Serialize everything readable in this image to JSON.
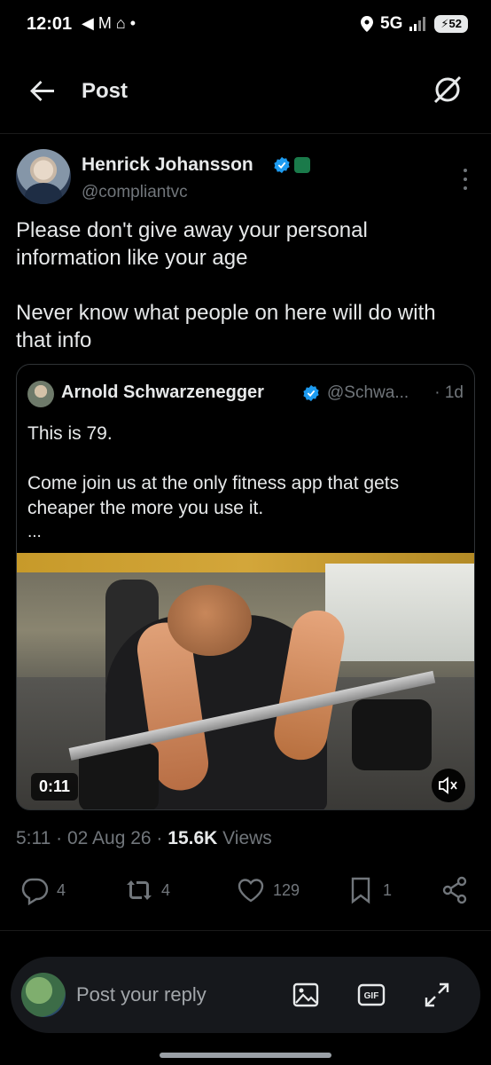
{
  "status_bar": {
    "time": "12:01",
    "left_icons": "◀ M ⌂ •",
    "network": "5G",
    "battery": "52"
  },
  "header": {
    "title": "Post",
    "back_icon": "arrow-left-icon",
    "grok_icon": "grok-icon"
  },
  "author": {
    "name": "Henrick Johansson",
    "handle": "@compliantvc",
    "verified_color": "#1d9bf0",
    "affiliation_color": "#1a7a4a"
  },
  "post": {
    "text": "Please don't give away your personal information like your age\n\nNever know what people on here will do with that info"
  },
  "quote": {
    "name": "Arnold Schwarzenegger",
    "handle": "@Schwa...",
    "time": "· 1d",
    "text": "This is 79.\n\nCome join us at the only fitness app that gets cheaper the more you use it.",
    "more": "...",
    "video": {
      "duration": "0:11",
      "mute_icon": "volume-mute-icon"
    }
  },
  "meta": {
    "time": "5:11",
    "sep1": " · ",
    "date": "02 Aug 26",
    "sep2": " · ",
    "views_count": "15.6K",
    "views_label": " Views"
  },
  "actions": {
    "replies": "4",
    "reposts": "4",
    "likes": "129",
    "bookmarks": "1"
  },
  "reply_bar": {
    "placeholder": "Post your reply",
    "icons": [
      "image-icon",
      "gif-icon",
      "expand-icon"
    ]
  },
  "colors": {
    "background": "#000000",
    "text": "#e7e9ea",
    "muted": "#71767b",
    "accent": "#1d9bf0"
  }
}
